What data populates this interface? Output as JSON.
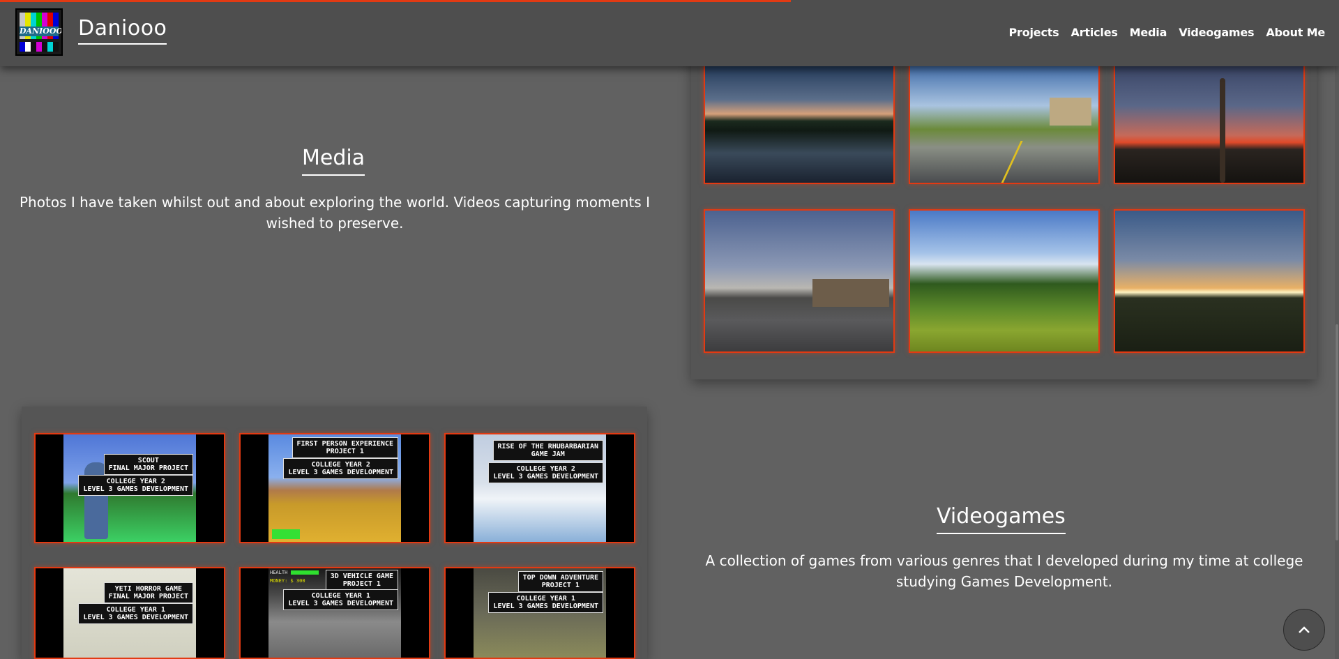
{
  "header": {
    "brand": "Danіooo",
    "logo_text": "DANIOOO",
    "scroll_progress": 0.59,
    "nav": [
      "Projects",
      "Articles",
      "Media",
      "Videogames",
      "About Me"
    ]
  },
  "media": {
    "title": "Media",
    "description": "Photos I have taken whilst out and about exploring the world. Videos capturing moments I wished to preserve."
  },
  "videogames": {
    "title": "Videogames",
    "description": "A collection of games from various genres that I developed during my time at college studying Games Development."
  },
  "photos": [
    {
      "name": "lake-at-dusk-photo"
    },
    {
      "name": "country-road-photo"
    },
    {
      "name": "sunset-grass-photo"
    },
    {
      "name": "car-park-buildings-photo"
    },
    {
      "name": "green-meadow-photo"
    },
    {
      "name": "sunset-trees-photo"
    }
  ],
  "games": [
    {
      "line1": "SCOUT\nFINAL MAJOR PROJECT",
      "line2": "COLLEGE YEAR 2\nLEVEL 3 GAMES DEVELOPMENT"
    },
    {
      "line1": "FIRST PERSON EXPERIENCE\nPROJECT 1",
      "line2": "COLLEGE YEAR 2\nLEVEL 3 GAMES DEVELOPMENT"
    },
    {
      "line1": "RISE OF THE RHUBARBARIAN\nGAME JAM",
      "line2": "COLLEGE YEAR 2\nLEVEL 3 GAMES DEVELOPMENT"
    },
    {
      "line1": "YETI HORROR GAME\nFINAL MAJOR PROJECT",
      "line2": "COLLEGE YEAR 1\nLEVEL 3 GAMES DEVELOPMENT"
    },
    {
      "line1": "3D VEHICLE GAME\nPROJECT 1",
      "line2": "COLLEGE YEAR 1\nLEVEL 3 GAMES DEVELOPMENT"
    },
    {
      "line1": "TOP DOWN ADVENTURE\nPROJECT 1",
      "line2": "COLLEGE YEAR 1\nLEVEL 3 GAMES DEVELOPMENT"
    }
  ],
  "game_hud": {
    "health_label": "HEALTH",
    "money_label": "MONEY: $ 300"
  },
  "colors": {
    "accent": "#e23a13",
    "background": "#616161",
    "header": "#4e4e4e"
  },
  "icons": {
    "scroll_top": "chevron-up-icon"
  }
}
